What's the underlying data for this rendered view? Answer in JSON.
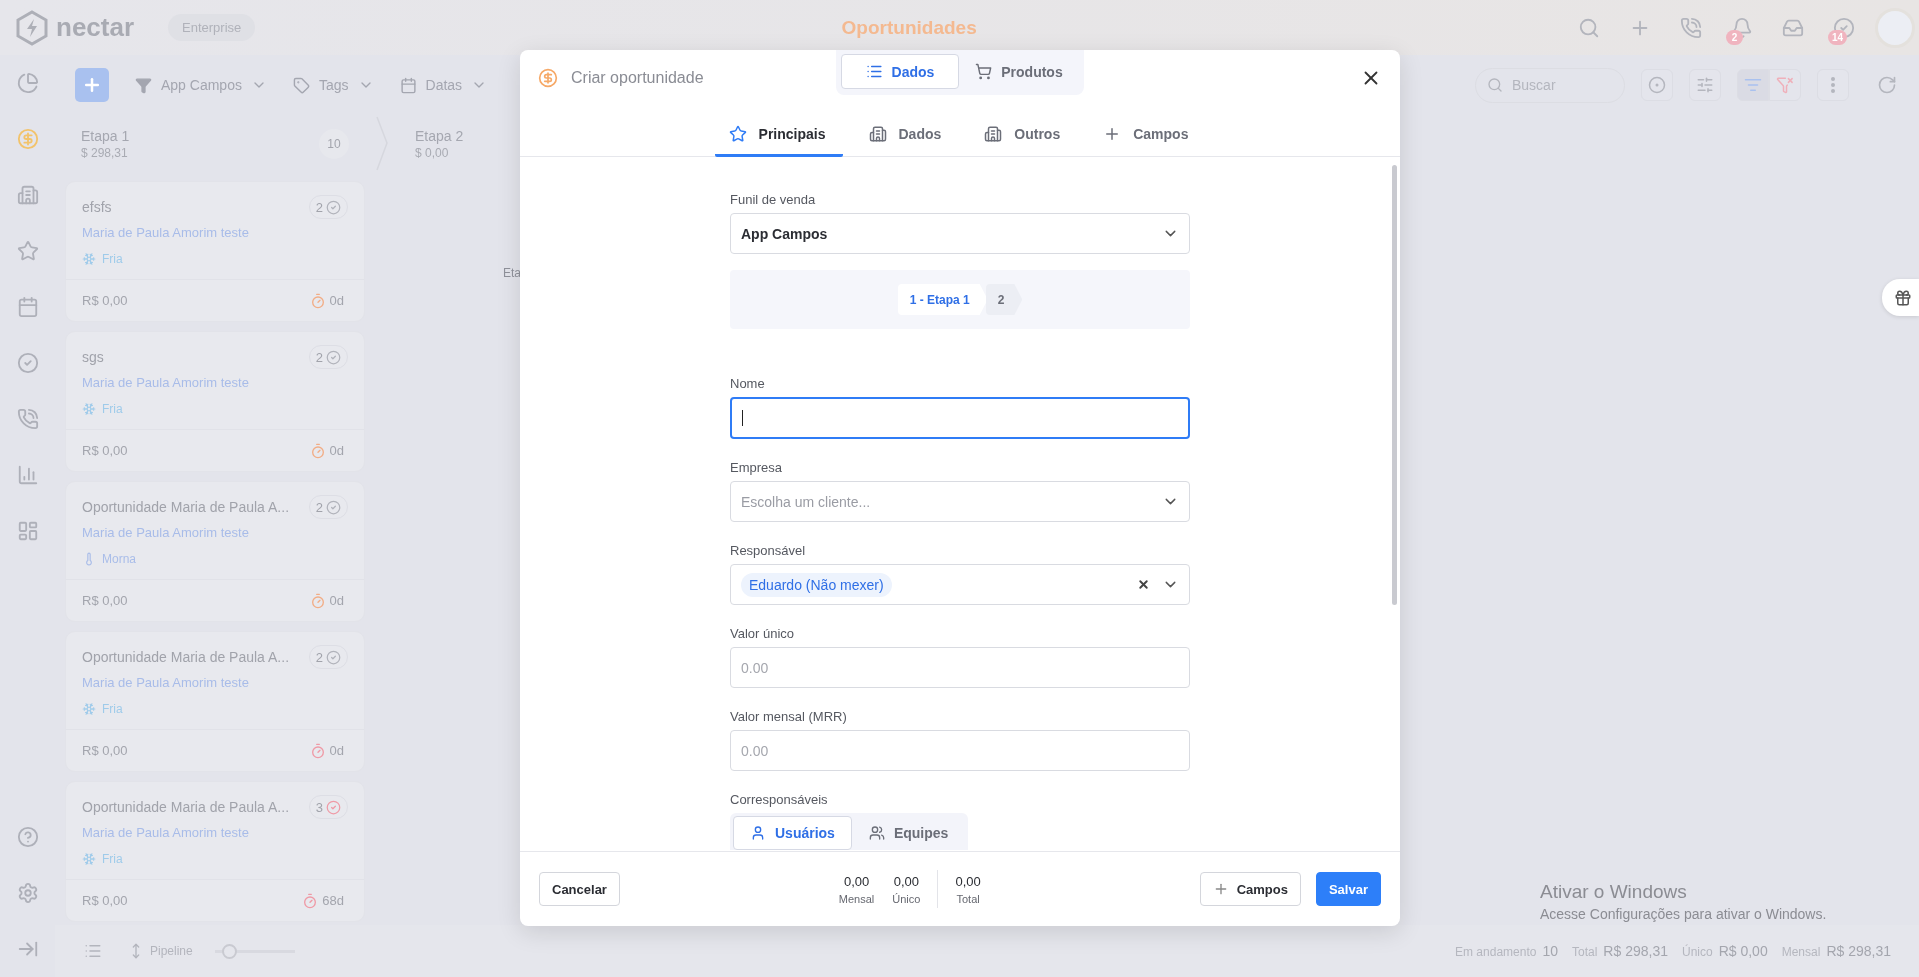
{
  "app": {
    "logo": "nectar",
    "plan": "Enterprise",
    "title": "Oportunidades"
  },
  "header_actions": [
    {
      "kind": "search"
    },
    {
      "kind": "plus"
    },
    {
      "kind": "phone"
    },
    {
      "kind": "bell",
      "badge": "2"
    },
    {
      "kind": "inbox"
    },
    {
      "kind": "tasks",
      "badge": "14"
    }
  ],
  "nav": {
    "main": [
      {
        "kind": "chart",
        "selected": false
      },
      {
        "kind": "deals",
        "selected": true
      },
      {
        "kind": "companies",
        "selected": false
      },
      {
        "kind": "favorites",
        "selected": false
      },
      {
        "kind": "calendar",
        "selected": false
      },
      {
        "kind": "tasks",
        "selected": false
      },
      {
        "kind": "calls",
        "selected": false
      },
      {
        "kind": "reports",
        "selected": false
      },
      {
        "kind": "dashboards",
        "selected": false
      }
    ],
    "bottom": [
      {
        "kind": "help",
        "selected": false
      },
      {
        "kind": "settings",
        "selected": false
      },
      {
        "kind": "expand",
        "selected": false
      }
    ]
  },
  "toolbar": {
    "filters": [
      {
        "kind": "funnel",
        "label": "App Campos"
      },
      {
        "kind": "tags",
        "label": "Tags"
      },
      {
        "kind": "dates",
        "label": "Datas"
      }
    ],
    "search_placeholder": "Buscar"
  },
  "columns": [
    {
      "name": "Etapa 1",
      "amount": "$ 298,31",
      "count": "10"
    },
    {
      "name": "Etapa 2",
      "amount": "$ 0,00",
      "note": "Eta"
    }
  ],
  "cards": [
    {
      "title": "efsfs",
      "tasks": "2",
      "tasks_overdue": false,
      "contact": "Maria de Paula Amorim teste",
      "temperature": {
        "kind": "cold",
        "label": "Fria"
      },
      "value": "R$ 0,00",
      "age": "0d",
      "color": "#f2ad86"
    },
    {
      "title": "sgs",
      "tasks": "2",
      "tasks_overdue": false,
      "contact": "Maria de Paula Amorim teste",
      "temperature": {
        "kind": "cold",
        "label": "Fria"
      },
      "value": "R$ 0,00",
      "age": "0d",
      "color": "#f2ad86"
    },
    {
      "title": "Oportunidade Maria de Paula A...",
      "tasks": "2",
      "tasks_overdue": false,
      "contact": "Maria de Paula Amorim teste",
      "temperature": {
        "kind": "warm",
        "label": "Morna"
      },
      "value": "R$ 0,00",
      "age": "0d",
      "color": "#f2ad86"
    },
    {
      "title": "Oportunidade Maria de Paula A...",
      "tasks": "2",
      "tasks_overdue": false,
      "contact": "Maria de Paula Amorim teste",
      "temperature": {
        "kind": "cold",
        "label": "Fria"
      },
      "value": "R$ 0,00",
      "age": "0d",
      "color": "#ef9aa6"
    },
    {
      "title": "Oportunidade Maria de Paula A...",
      "tasks": "3",
      "tasks_overdue": true,
      "contact": "Maria de Paula Amorim teste",
      "temperature": {
        "kind": "cold",
        "label": "Fria"
      },
      "value": "R$ 0,00",
      "age": "68d",
      "color": "#ef9aa6"
    }
  ],
  "bottom_bar": {
    "view": "Pipeline",
    "zoom": {
      "level": 0.18
    },
    "stats": [
      {
        "label": "Em andamento",
        "value": "10"
      },
      {
        "label": "Total",
        "value": "R$ 298,31"
      },
      {
        "label": "Único",
        "value": "R$ 0,00"
      },
      {
        "label": "Mensal",
        "value": "R$ 298,31"
      }
    ]
  },
  "modal": {
    "title": "Criar oportunidade",
    "views": [
      {
        "kind": "list",
        "label": "Dados",
        "selected": true
      },
      {
        "kind": "cart",
        "label": "Produtos",
        "selected": false
      }
    ],
    "tabs": [
      {
        "kind": "star",
        "label": "Principais",
        "selected": true
      },
      {
        "kind": "building",
        "label": "Dados",
        "selected": false
      },
      {
        "kind": "building",
        "label": "Outros",
        "selected": false
      },
      {
        "kind": "plus",
        "label": "Campos",
        "selected": false
      }
    ],
    "fields": [
      {
        "kind": "select",
        "label": "Funil de venda",
        "value": "App Campos"
      },
      {
        "kind": "stages",
        "stages": [
          {
            "label": "1 - Etapa 1",
            "selected": true
          },
          {
            "label": "2",
            "selected": false
          }
        ]
      },
      {
        "kind": "text",
        "label": "Nome",
        "focused": true
      },
      {
        "kind": "select",
        "label": "Empresa",
        "placeholder": "Escolha um cliente..."
      },
      {
        "kind": "tag_select",
        "label": "Responsável",
        "tag": "Eduardo (Não mexer)"
      },
      {
        "kind": "text",
        "label": "Valor único",
        "placeholder": "0.00",
        "focused": false
      },
      {
        "kind": "text",
        "label": "Valor mensal (MRR)",
        "placeholder": "0.00",
        "focused": false
      },
      {
        "kind": "segmented",
        "label": "Corresponsáveis",
        "options": [
          {
            "kind": "user",
            "label": "Usuários",
            "selected": true
          },
          {
            "kind": "users",
            "label": "Equipes",
            "selected": false
          }
        ]
      }
    ],
    "footer": {
      "cancel": "Cancelar",
      "totals": [
        {
          "value": "0,00",
          "label": "Mensal"
        },
        {
          "value": "0,00",
          "label": "Único"
        },
        {
          "value": "0,00",
          "label": "Total"
        }
      ],
      "fields_button": "Campos",
      "save": "Salvar"
    }
  },
  "os_notice": {
    "title": "Ativar o Windows",
    "text": "Acesse Configurações para ativar o Windows."
  }
}
